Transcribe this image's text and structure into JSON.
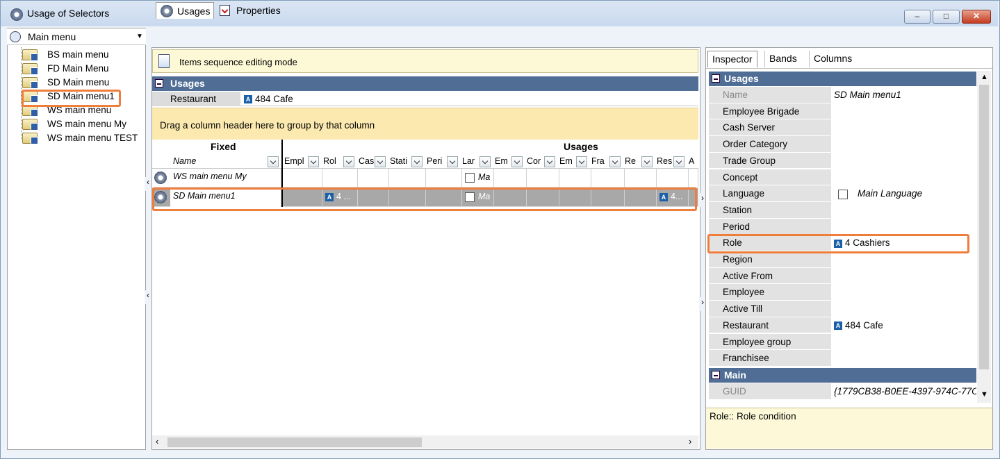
{
  "window": {
    "title": "Usage of Selectors",
    "min": "–",
    "max": "□",
    "close": "✕"
  },
  "left": {
    "selector": "Main menu",
    "tree": [
      "BS main menu",
      "FD Main Menu",
      "SD Main menu",
      "SD Main menu1",
      "WS main menu",
      "WS main menu My",
      "WS main menu TEST"
    ],
    "selected_index": 3
  },
  "tabs": {
    "usages": "Usages",
    "properties": "Properties"
  },
  "center": {
    "seq_mode": "Items sequence editing mode",
    "band": "Usages",
    "restaurant_label": "Restaurant",
    "restaurant_value": "484 Cafe",
    "group_hint": "Drag a column header here to group by that column",
    "band_fixed": "Fixed",
    "band_usages": "Usages",
    "col_name": "Name",
    "columns": [
      "Empl",
      "Rol",
      "Cas",
      "Stati",
      "Peri",
      "Lar",
      "Em",
      "Cor",
      "Em",
      "Fra",
      "Re",
      "Res",
      "A"
    ],
    "rows": [
      {
        "name": "WS main menu My",
        "role": "",
        "lang": "Ma",
        "rest": ""
      },
      {
        "name": "SD Main menu1",
        "role": "4 ...",
        "lang": "Ma",
        "rest": "4..."
      }
    ]
  },
  "inspector": {
    "tabs": [
      "Inspector",
      "Bands",
      "Columns"
    ],
    "band_usages": "Usages",
    "band_main": "Main",
    "props": [
      {
        "k": "Name",
        "v": "SD Main menu1",
        "type": "italic",
        "dis": true
      },
      {
        "k": "Employee Brigade",
        "v": ""
      },
      {
        "k": "Cash Server",
        "v": ""
      },
      {
        "k": "Order Category",
        "v": ""
      },
      {
        "k": "Trade Group",
        "v": ""
      },
      {
        "k": "Concept",
        "v": ""
      },
      {
        "k": "Language",
        "v": "Main Language",
        "type": "check"
      },
      {
        "k": "Station",
        "v": ""
      },
      {
        "k": "Period",
        "v": ""
      },
      {
        "k": "Role",
        "v": "4 Cashiers",
        "type": "ref"
      },
      {
        "k": "Region",
        "v": ""
      },
      {
        "k": "Active From",
        "v": ""
      },
      {
        "k": "Employee",
        "v": ""
      },
      {
        "k": "Active Till",
        "v": ""
      },
      {
        "k": "Restaurant",
        "v": "484 Cafe",
        "type": "ref"
      },
      {
        "k": "Employee group",
        "v": ""
      },
      {
        "k": "Franchisee",
        "v": ""
      }
    ],
    "guid_label": "GUID",
    "guid_value": "{1779CB38-B0EE-4397-974C-77C",
    "description": "Role:: Role condition"
  }
}
